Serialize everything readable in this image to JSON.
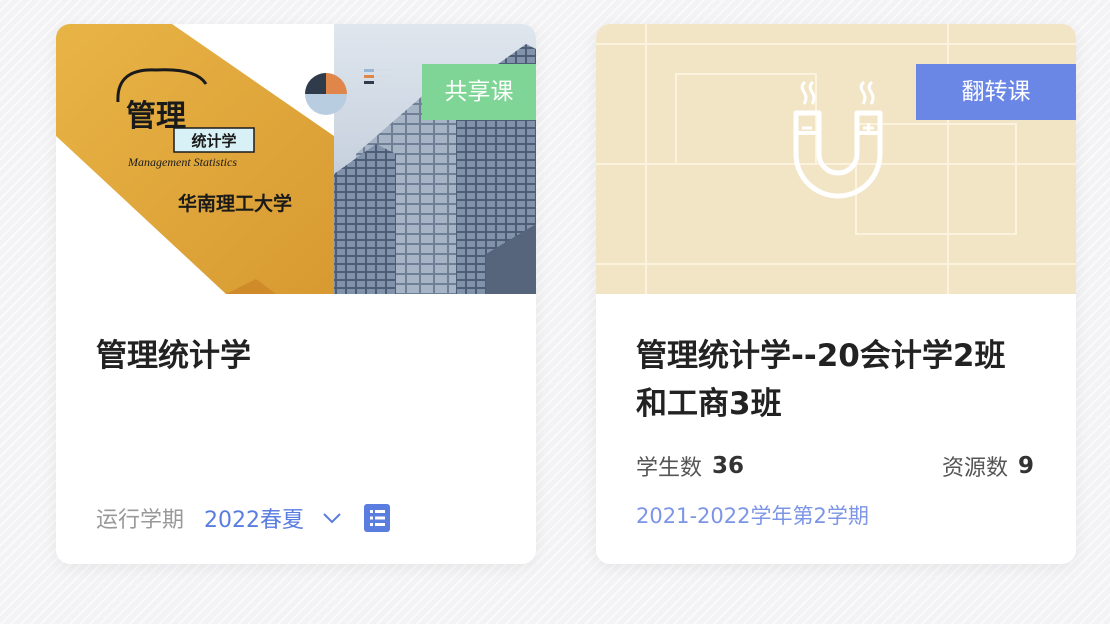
{
  "courses": [
    {
      "badge": "共享课",
      "badge_color": "#7ed595",
      "cover": {
        "logo_title": "管理",
        "logo_subtitle": "统计学",
        "logo_english": "Management Statistics",
        "university": "华南理工大学",
        "accent_color": "#e3a93d"
      },
      "title": "管理统计学",
      "term_label": "运行学期",
      "term_value": "2022春夏",
      "icons": [
        "chevron-down-icon",
        "list-icon"
      ]
    },
    {
      "badge": "翻转课",
      "badge_color": "#6b87e6",
      "cover": {
        "background_color": "#f2e5c6",
        "icon": "magnet-icon"
      },
      "title": "管理统计学--20会计学2班和工商3班",
      "students_label": "学生数",
      "students_value": "36",
      "resources_label": "资源数",
      "resources_value": "9",
      "semester": "2021-2022学年第2学期"
    }
  ]
}
